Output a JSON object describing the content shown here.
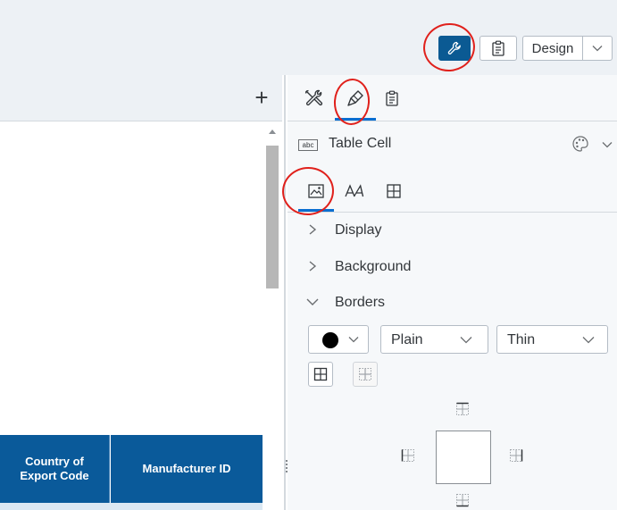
{
  "toolbar": {
    "design_label": "Design",
    "icons": [
      "wrench-icon",
      "clipboard-icon",
      "chevron-down-icon"
    ],
    "active_color": "#0b5a93"
  },
  "left_panel": {
    "add_label": "+",
    "table": {
      "headers": [
        "Country of\nExport Code",
        "Manufacturer ID"
      ]
    },
    "header_color": "#0a5a9a"
  },
  "right_panel": {
    "tabs": [
      "tools-icon",
      "brush-icon",
      "clipboard-icon"
    ],
    "active_tab": "brush-icon",
    "object_badge": "abc",
    "object_title": "Table Cell",
    "subtabs": [
      "image-style-icon",
      "font-icon",
      "table-grid-icon"
    ],
    "active_subtab": "image-style-icon",
    "sections": [
      {
        "label": "Display",
        "expanded": false
      },
      {
        "label": "Background",
        "expanded": false
      },
      {
        "label": "Borders",
        "expanded": true
      }
    ],
    "borders": {
      "color": "#000000",
      "style": "Plain",
      "width": "Thin"
    }
  },
  "annotations": {
    "circle_color": "#e0201b"
  }
}
